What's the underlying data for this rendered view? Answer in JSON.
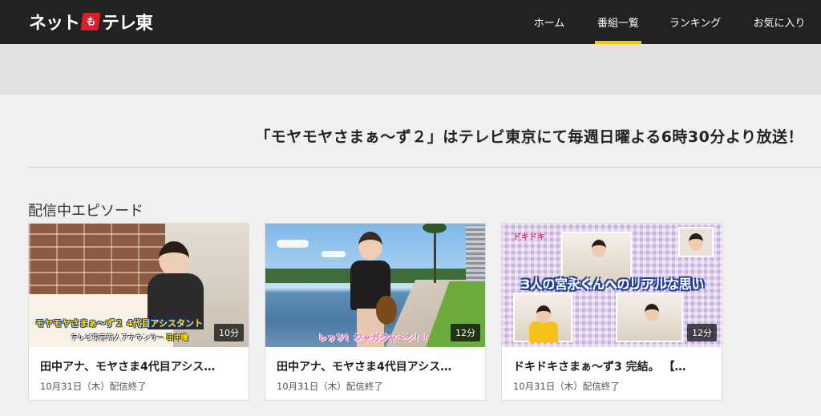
{
  "header": {
    "logo_text_left": "ネット",
    "logo_text_mid": "も",
    "logo_text_right": "テレ東",
    "nav": [
      {
        "label": "ホーム",
        "active": false
      },
      {
        "label": "番組一覧",
        "active": true
      },
      {
        "label": "ランキング",
        "active": false
      },
      {
        "label": "お気に入り",
        "active": false
      }
    ],
    "accent_color": "#f7c600",
    "background_color": "#222222"
  },
  "notice": "「モヤモヤさまぁ〜ず２」はテレビ東京にて毎週日曜よる6時30分より放送！",
  "section": {
    "title": "配信中エピソード"
  },
  "episodes": [
    {
      "title": "田中アナ、モヤさま4代目アシス…",
      "date": "10月31日（木）配信終了",
      "duration": "10分",
      "thumb_caption_1": "モヤモヤさまぁ〜ず２ 4代目アシスタント",
      "thumb_caption_2_prefix": "テレビ東京新人アナウンサー ",
      "thumb_caption_2_name": "田中瞳"
    },
    {
      "title": "田中アナ、モヤさま4代目アシス…",
      "date": "10月31日（木）配信終了",
      "duration": "12分",
      "thumb_caption": "レッツ！ジャガジャ〜ン！！"
    },
    {
      "title": "ドキドキさまぁ〜ず3 完結。 【…",
      "date": "10月31日（木）配信終了",
      "duration": "12分",
      "thumb_stamp": "ドキドキ",
      "thumb_caption": "3人の宮永くんへのリアルな思い"
    }
  ]
}
